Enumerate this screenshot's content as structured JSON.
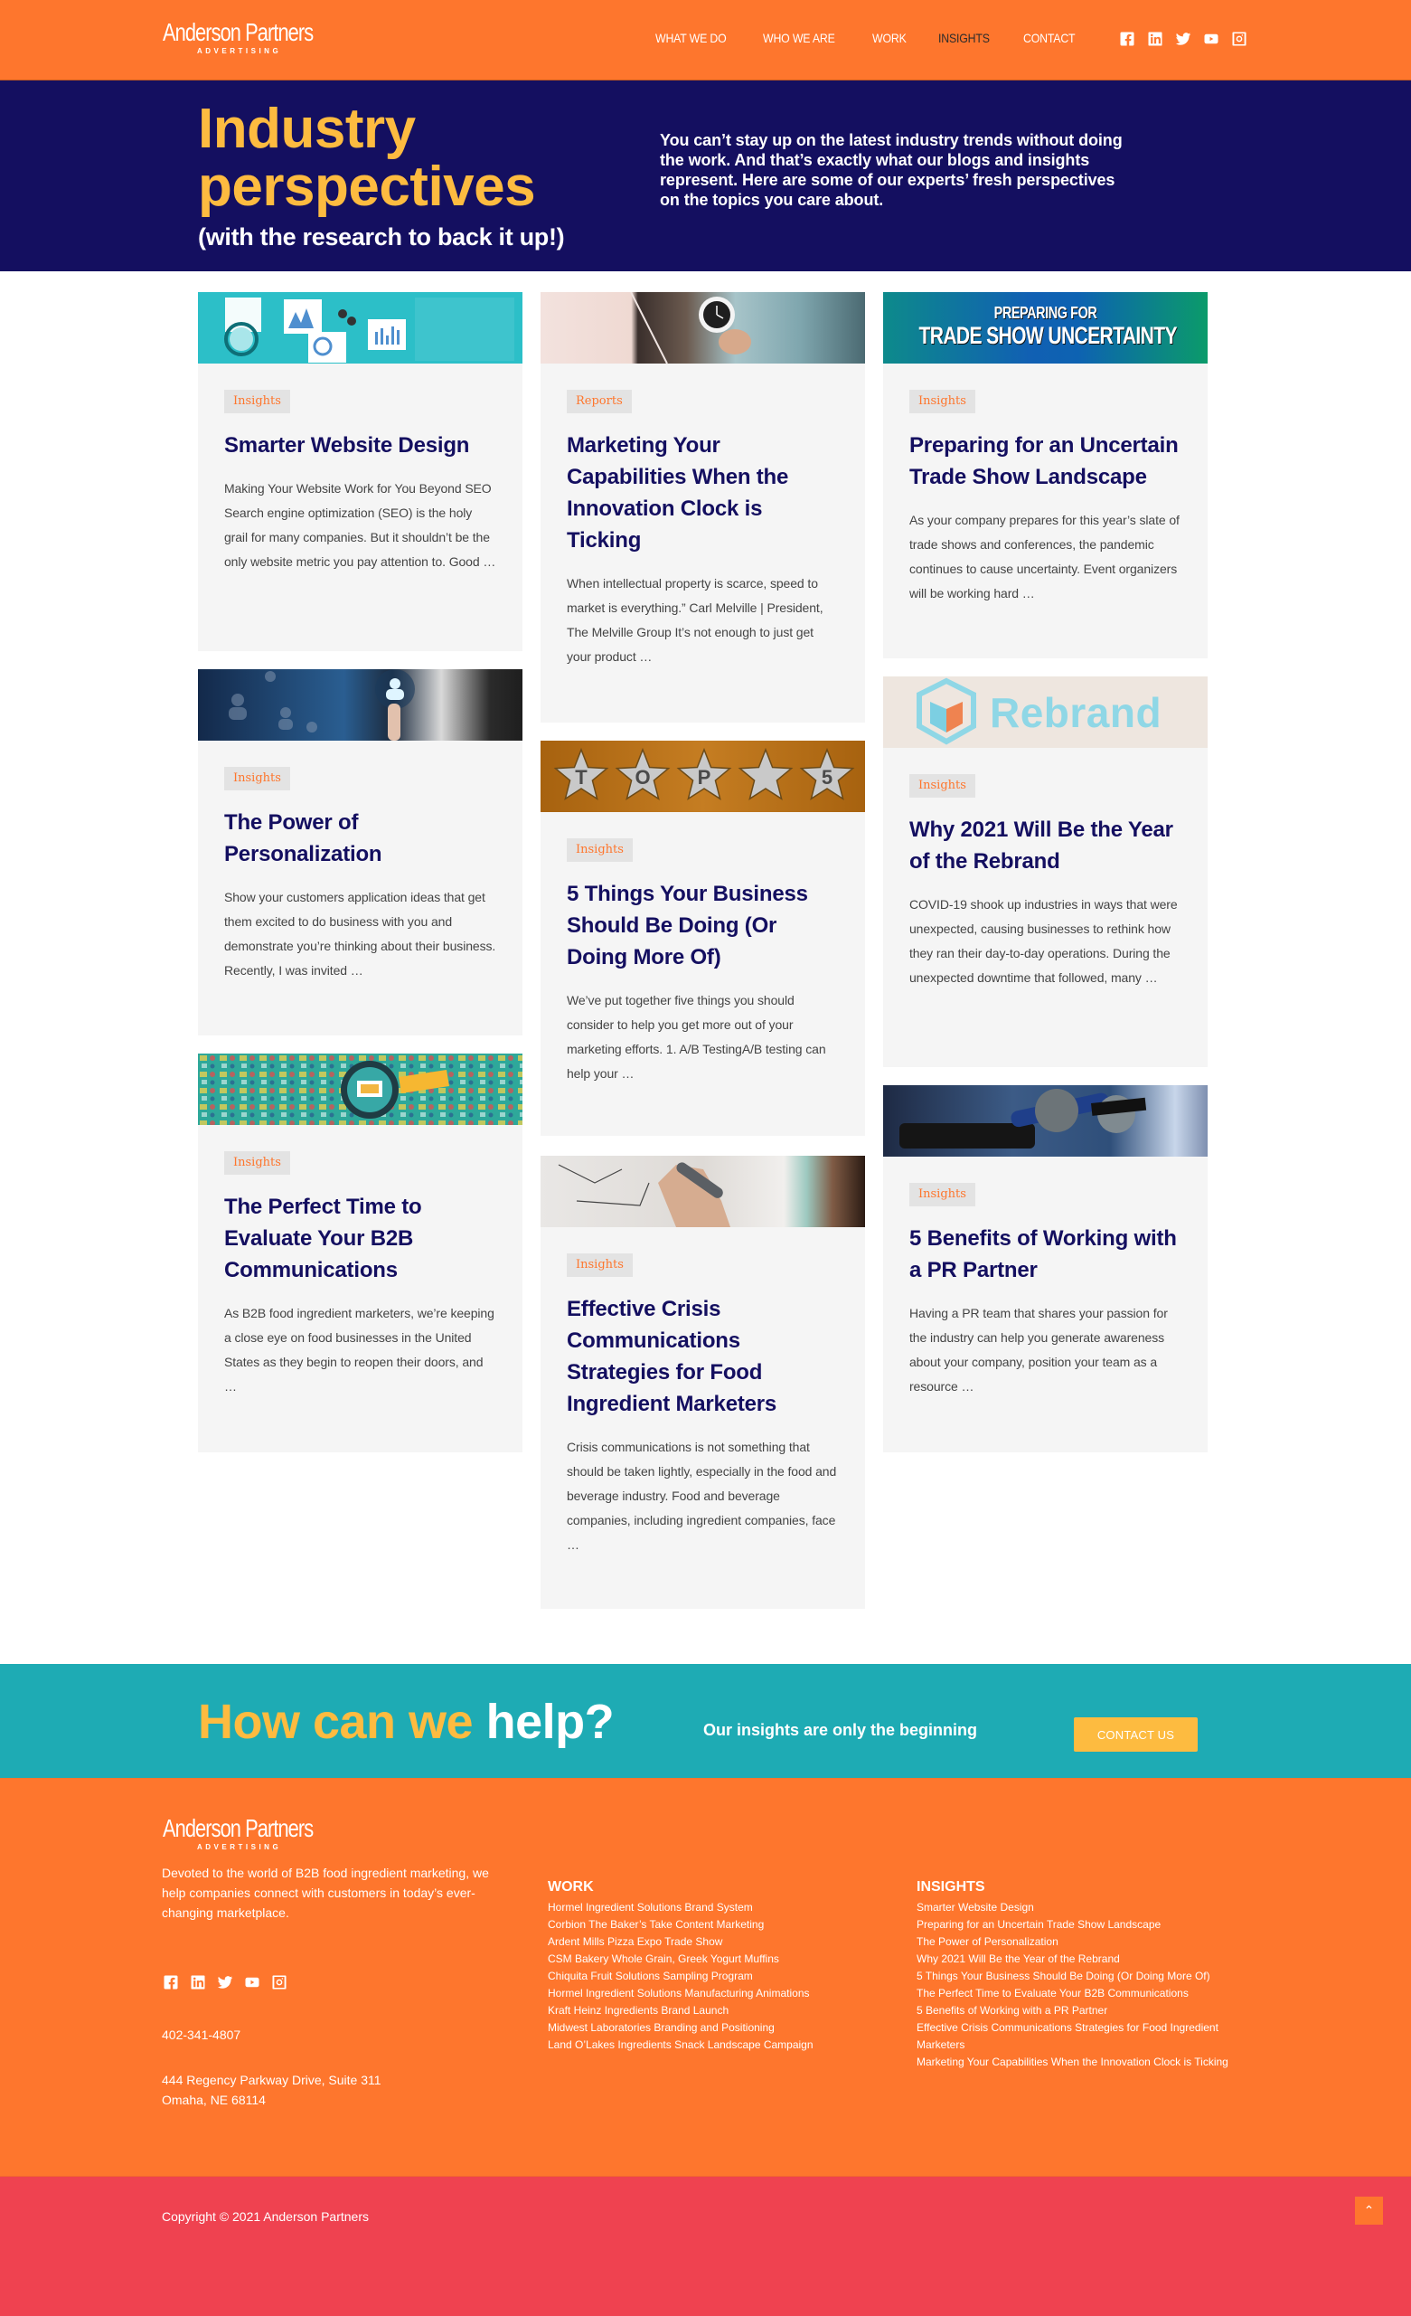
{
  "brand": {
    "name": "Anderson Partners",
    "tagline": "ADVERTISING",
    "colors": {
      "orange": "#fe762d",
      "navy": "#140f60",
      "yellow": "#fdbb40",
      "teal": "#1eabb4",
      "red": "#ef4250"
    }
  },
  "nav": {
    "items": [
      {
        "label": "WHAT WE DO"
      },
      {
        "label": "WHO WE ARE"
      },
      {
        "label": "WORK"
      },
      {
        "label": "INSIGHTS",
        "active": true
      },
      {
        "label": "CONTACT"
      }
    ],
    "social_icons": [
      "facebook-icon",
      "linkedin-icon",
      "twitter-icon",
      "youtube-icon",
      "instagram-icon"
    ]
  },
  "hero": {
    "title_line1": "Industry",
    "title_line2": "perspectives",
    "subtitle": "(with the research to back it up!)",
    "description": "You can’t stay up on the latest industry trends without doing the work. And that’s exactly what our blogs and insights represent. Here are some of our experts’ fresh perspectives on the topics you care about."
  },
  "cards": [
    {
      "category": "Insights",
      "title": "Smarter Website Design",
      "excerpt": "Making Your Website Work for You Beyond SEO Search engine optimization (SEO) is the holy grail for many companies. But it shouldn’t be the only website metric you pay attention to. Good …",
      "image": "website-analytics-illustration"
    },
    {
      "category": "Reports",
      "title": "Marketing Your Capabilities When the Innovation Clock is Ticking",
      "excerpt": "When intellectual property is scarce, speed to market is everything.” Carl Melville | President, The Melville Group It’s not enough to just get your product …",
      "image": "hand-holding-clock-photo"
    },
    {
      "category": "Insights",
      "title": "Preparing for an Uncertain Trade Show Landscape",
      "excerpt": "As your company prepares for this year’s slate of trade shows and conferences, the pandemic continues to cause uncertainty. Event organizers will be working hard …",
      "image": "trade-show-banner",
      "image_text_line1": "PREPARING FOR",
      "image_text_line2": "TRADE SHOW UNCERTAINTY"
    },
    {
      "category": "Insights",
      "title": "The Power of Personalization",
      "excerpt": "Show your customers application ideas that get them excited to do business with you and demonstrate you’re thinking about their business. Recently, I was invited …",
      "image": "personalization-photo"
    },
    {
      "category": "Insights",
      "title": "5 Things Your Business Should Be Doing (Or Doing More Of)",
      "excerpt": "We’ve put together five things you should consider to help you get more out of your marketing efforts. 1. A/B TestingA/B testing can help your …",
      "image": "top-5-stars",
      "image_stars": [
        "T",
        "O",
        "P",
        "",
        "5"
      ]
    },
    {
      "category": "Insights",
      "title": "Why 2021 Will Be the Year of the Rebrand",
      "excerpt": "COVID-19 shook up industries in ways that were unexpected, causing businesses to rethink how they ran their day-to-day operations. During the unexpected downtime that followed, many …",
      "image": "rebrand-graphic",
      "image_text": "Rebrand"
    },
    {
      "category": "Insights",
      "title": "The Perfect Time to Evaluate Your B2B Communications",
      "excerpt": "As B2B food ingredient marketers, we’re keeping a close eye on food businesses in the United States as they begin to reopen their doors, and …",
      "image": "magnifier-pattern-illustration"
    },
    {
      "category": "Insights",
      "title": "Effective Crisis Communications Strategies for Food Ingredient Marketers",
      "excerpt": "Crisis communications is not something that should be taken lightly, especially in the food and beverage industry. Food and beverage companies, including ingredient companies, face …",
      "image": "whiteboard-drawing-photo"
    },
    {
      "category": "Insights",
      "title": "5 Benefits of Working with a PR Partner",
      "excerpt": "Having a PR team that shares your passion for the industry can help you generate awareness about your company, position your team as a resource …",
      "image": "microphones-photo"
    }
  ],
  "cta": {
    "title_part1": "How can we",
    "title_part2": "help?",
    "subtitle": "Our insights are only the beginning",
    "button_label": "CONTACT US"
  },
  "footer": {
    "description": "Devoted to the world of B2B food ingredient marketing, we help companies connect with customers in today’s ever-changing marketplace.",
    "phone": "402-341-4807",
    "address_line1": "444 Regency Parkway Drive, Suite 311",
    "address_line2": "Omaha, NE 68114",
    "work": {
      "heading": "WORK",
      "links": [
        "Hormel Ingredient Solutions Brand System",
        "Corbion The Baker’s Take Content Marketing",
        "Ardent Mills Pizza Expo Trade Show",
        "CSM Bakery Whole Grain, Greek Yogurt Muffins",
        "Chiquita Fruit Solutions Sampling Program",
        "Hormel Ingredient Solutions Manufacturing Animations",
        "Kraft Heinz Ingredients Brand Launch",
        "Midwest Laboratories Branding and Positioning",
        "Land O’Lakes Ingredients Snack Landscape Campaign"
      ]
    },
    "insights": {
      "heading": "INSIGHTS",
      "links": [
        "Smarter Website Design",
        "Preparing for an Uncertain Trade Show Landscape",
        "The Power of Personalization",
        "Why 2021 Will Be the Year of the Rebrand",
        "5 Things Your Business Should Be Doing (Or Doing More Of)",
        "The Perfect Time to Evaluate Your B2B Communications",
        "5 Benefits of Working with a PR Partner",
        "Effective Crisis Communications Strategies for Food Ingredient Marketers",
        "Marketing Your Capabilities When the Innovation Clock is Ticking"
      ]
    }
  },
  "bottom": {
    "copyright": "Copyright © 2021 Anderson Partners",
    "scroll_top_icon": "chevron-up-icon"
  }
}
